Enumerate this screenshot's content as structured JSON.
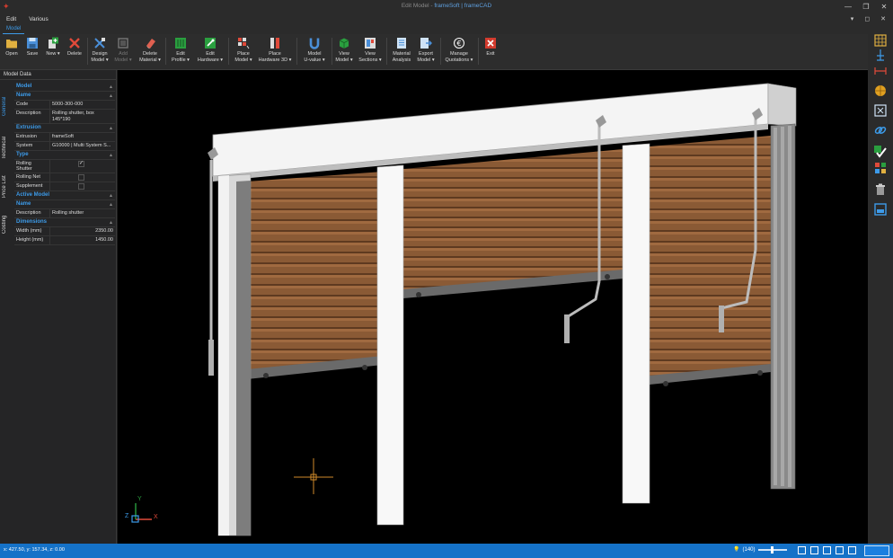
{
  "window": {
    "title_prefix": "Edit Model - ",
    "title_brand": "frameSoft | frameCAD",
    "minimize_glyph": "—",
    "restore_glyph": "❐",
    "close_glyph": "✕"
  },
  "menu": {
    "items": [
      "Edit",
      "Various"
    ],
    "right_glyphs": [
      "▾",
      "◻",
      "✕"
    ]
  },
  "ribbon": {
    "active_tab": "Model"
  },
  "toolbar": [
    {
      "label": "Open",
      "icon": "folder-icon"
    },
    {
      "label": "Save",
      "icon": "save-icon"
    },
    {
      "label": "New ▾",
      "icon": "new-icon"
    },
    {
      "label": "Delete",
      "icon": "delete-icon"
    },
    {
      "label": "Design\nModel ▾",
      "icon": "design-model-icon"
    },
    {
      "label": "Add\nModel ▾",
      "icon": "add-model-icon",
      "disabled": true
    },
    {
      "label": "Delete\nMaterial ▾",
      "icon": "eraser-icon"
    },
    {
      "label": "Edit\nProfile ▾",
      "icon": "edit-profile-icon"
    },
    {
      "label": "Edit\nHardware ▾",
      "icon": "edit-hardware-icon"
    },
    {
      "label": "Place\nModel ▾",
      "icon": "place-model-icon"
    },
    {
      "label": "Place\nHardware 3D ▾",
      "icon": "place-hardware-icon"
    },
    {
      "label": "Model\nU-value ▾",
      "icon": "u-value-icon"
    },
    {
      "label": "View\nModel ▾",
      "icon": "view-model-icon"
    },
    {
      "label": "View\nSections ▾",
      "icon": "view-sections-icon"
    },
    {
      "label": "Material\nAnalysis",
      "icon": "material-analysis-icon"
    },
    {
      "label": "Export\nModel ▾",
      "icon": "export-icon"
    },
    {
      "label": "Manage\nQuotations ▾",
      "icon": "euro-icon"
    },
    {
      "label": "Exit",
      "icon": "exit-icon"
    }
  ],
  "panel": {
    "title": "Model Data",
    "tabs": [
      "General",
      "Technical",
      "Price List",
      "Costing"
    ],
    "sections": {
      "model": "Model",
      "name": "Name",
      "extrusion": "Extrusion",
      "type": "Type",
      "active_model": "Active Model",
      "active_name": "Name",
      "dimensions": "Dimensions"
    },
    "collapse_glyph": "▴",
    "code_label": "Code",
    "code_value": "5000-300-000",
    "desc_label": "Description",
    "desc_value": "Rolling shutter, box 145*190",
    "extrusion_label": "Extrusion",
    "extrusion_value": "frameSoft",
    "system_label": "System",
    "system_value": "G10000 | Multi System S...",
    "type_rolling_shutter": "Rolling Shutter",
    "type_rolling_net": "Rolling Net",
    "type_supplement": "Supplement",
    "type_checked": [
      true,
      false,
      false
    ],
    "active_desc_label": "Description",
    "active_desc_value": "Rolling shutter",
    "width_label": "Width (mm)",
    "width_value": "2350.00",
    "height_label": "Height (mm)",
    "height_value": "1450.00"
  },
  "viewport": {
    "axis_x": "X",
    "axis_y": "Y",
    "axis_z": "Z"
  },
  "status": {
    "coords": "x: 427.50, y: 157.34, z: 0.00",
    "zoom": "(140)"
  },
  "colors": {
    "accent": "#3d9be9",
    "status_bar": "#1572c8",
    "slat_wood": "#8a5a35",
    "frame_white": "#f4f4f4"
  }
}
